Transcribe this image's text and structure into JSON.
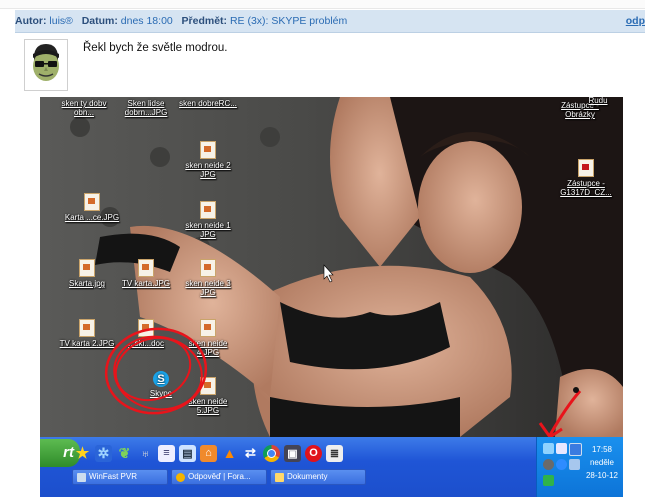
{
  "post_header": {
    "author_label": "Autor:",
    "author": "luis®",
    "date_label": "Datum:",
    "date": "dnes 18:00",
    "subject_label": "Předmět:",
    "subject": "RE (3x): SKYPE problém",
    "reply_link": "odp"
  },
  "post": {
    "message": "Řekl bych že světle modrou."
  },
  "desktop": {
    "icons": [
      {
        "label": "sken ty dobv obn..."
      },
      {
        "label": "Sken lidse dobrn...JPG"
      },
      {
        "label": "sken dobreRC..."
      },
      {
        "label": "sken neide 2 JPG"
      },
      {
        "label": "sken neide 1 JPG"
      },
      {
        "label": "Karta ...ce.JPG"
      },
      {
        "label": "Skarta.jpg"
      },
      {
        "label": "TV karta.JPG"
      },
      {
        "label": "sken neide 3 JPG"
      },
      {
        "label": "TV karta 2.JPG"
      },
      {
        "label": "...ski...doc"
      },
      {
        "label": "sken neide 4.JPG"
      },
      {
        "label": "sken neide 5.JPG"
      },
      {
        "label": "Zástupce - Obrázky"
      },
      {
        "label": "Zástupce - G1317D_CZ..."
      },
      {
        "label": "Rudu"
      }
    ],
    "skype_label": "Skype"
  },
  "taskbar": {
    "start_label": "rt",
    "tasks": [
      {
        "label": "WinFast PVR"
      },
      {
        "label": "Odpověď | Fora..."
      },
      {
        "label": "Dokumenty"
      }
    ],
    "clock": {
      "time": "17:58",
      "day": "neděle",
      "date": "28-10-12"
    }
  },
  "colors": {
    "header_bg": "#d6e4f2",
    "link": "#2a6bb3",
    "taskbar": "#1f55d6",
    "annotation_red": "#e8141b"
  }
}
